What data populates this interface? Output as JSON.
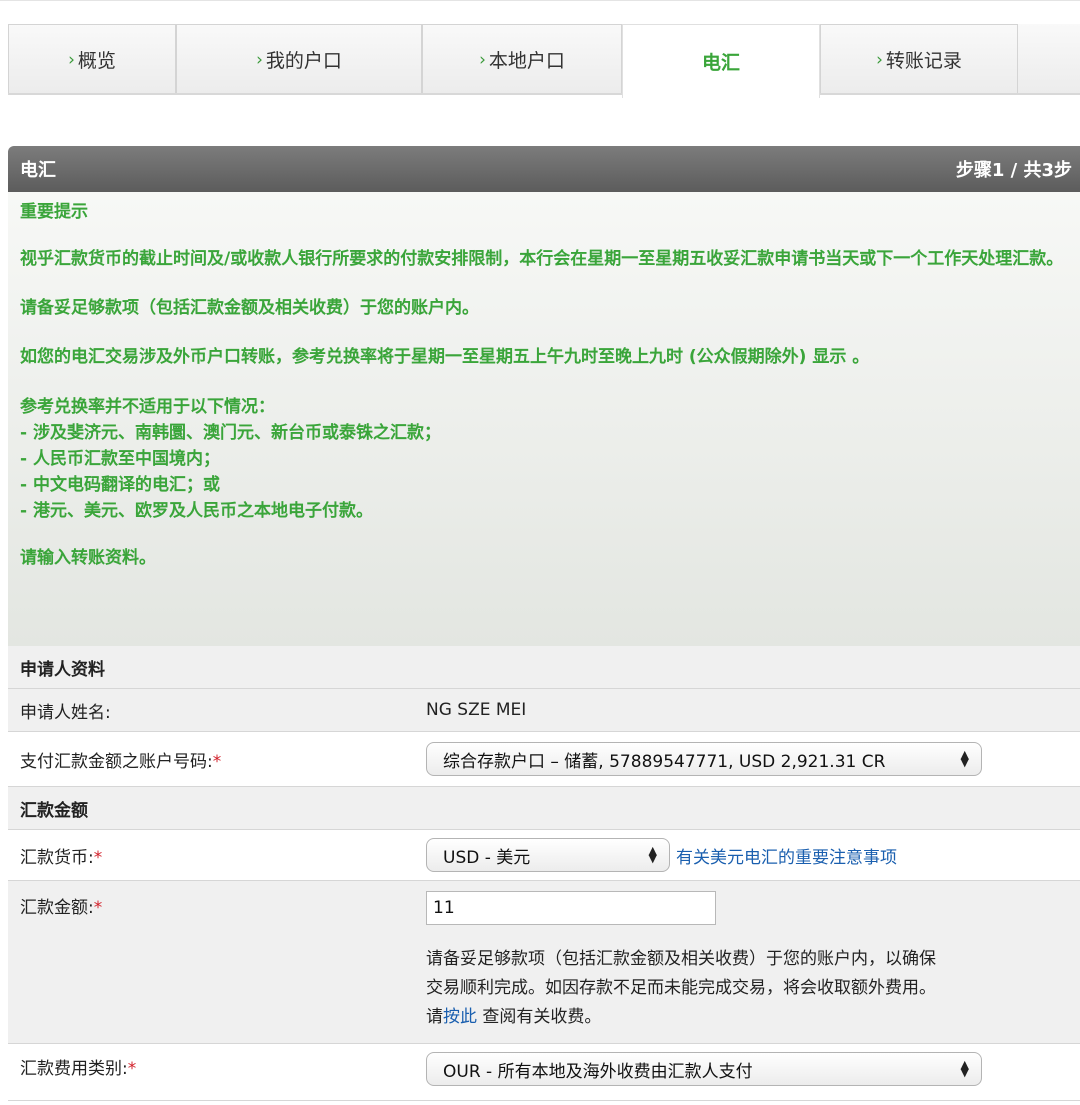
{
  "tabs": [
    {
      "label": "概览",
      "active": false
    },
    {
      "label": "我的户口",
      "active": false
    },
    {
      "label": "本地户口",
      "active": false
    },
    {
      "label": "电汇",
      "active": true
    },
    {
      "label": "转账记录",
      "active": false
    }
  ],
  "header": {
    "title": "电汇",
    "step": "步骤1 / 共3步"
  },
  "notice": {
    "heading": "重要提示",
    "p1": "视乎汇款货币的截止时间及/或收款人银行所要求的付款安排限制，本行会在星期一至星期五收妥汇款申请书当天或下一个工作天处理汇款。",
    "p2": "请备妥足够款项（包括汇款金额及相关收费）于您的账户内。",
    "p3": "如您的电汇交易涉及外币户口转账，参考兑换率将于星期一至星期五上午九时至晚上九时 (公众假期除外) 显示 。",
    "p4_title": "参考兑换率并不适用于以下情况：",
    "p4_items": [
      "- 涉及斐济元、南韩圜、澳门元、新台币或泰铢之汇款；",
      "- 人民币汇款至中国境内；",
      "- 中文电码翻译的电汇；或",
      "- 港元、美元、欧罗及人民币之本地电子付款。"
    ],
    "p5": "请输入转账资料。"
  },
  "applicant": {
    "section_title": "申请人资料",
    "name_label": "申请人姓名:",
    "name_value": "NG SZE MEI",
    "account_label": "支付汇款金额之账户号码:",
    "account_value": "综合存款户口 – 储蓄, 57889547771, USD 2,921.31 CR"
  },
  "amount": {
    "section_title": "汇款金额",
    "currency_label": "汇款货币:",
    "currency_value": "USD - 美元",
    "currency_link": "有关美元电汇的重要注意事项",
    "amount_label": "汇款金额:",
    "amount_value": "11",
    "note_line1": "请备妥足够款项（包括汇款金额及相关收费）于您的账户内，以确保",
    "note_line2": "交易顺利完成。如因存款不足而未能完成交易，将会收取额外费用。",
    "note_pre": "请",
    "note_link": "按此",
    "note_post": " 查阅有关收费。",
    "fee_label": "汇款费用类别:",
    "fee_value": "OUR - 所有本地及海外收费由汇款人支付"
  },
  "required_mark": "*",
  "colors": {
    "accent_green": "#3aa53a",
    "link_blue": "#1a5faf",
    "required_red": "#d2202a",
    "header_gray": "#6a6a6a"
  }
}
